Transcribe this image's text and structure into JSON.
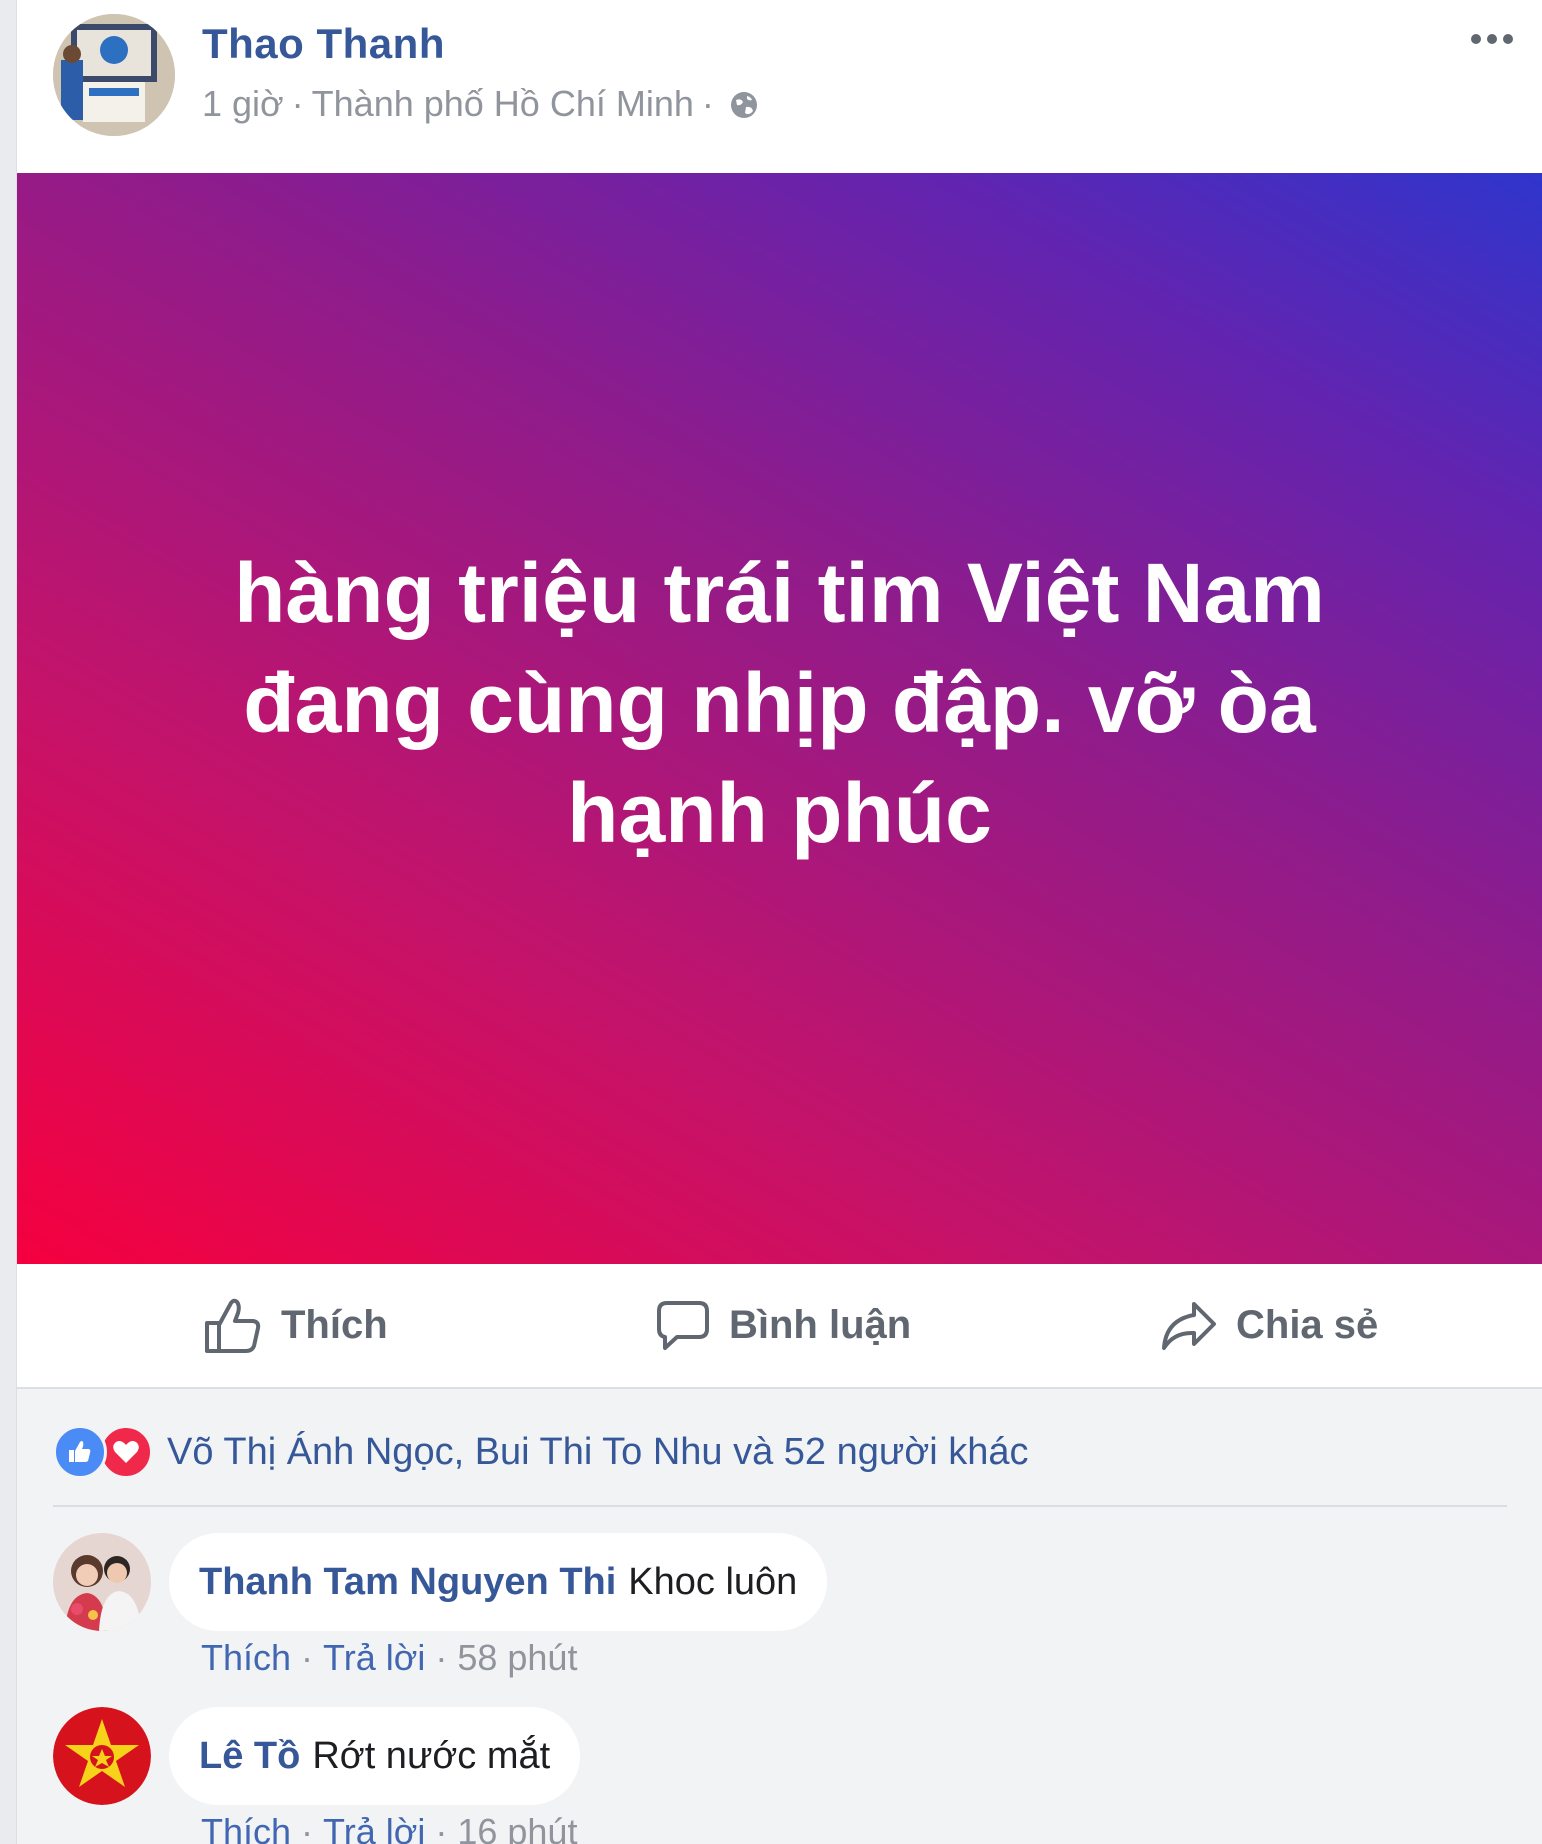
{
  "post": {
    "author": "Thao Thanh",
    "time": "1 giờ",
    "separator": "·",
    "location": "Thành phố Hồ Chí Minh",
    "privacy_icon": "globe-icon",
    "status_text": "hàng triệu trái tim Việt Nam đang cùng nhịp đập. vỡ òa hạnh phúc",
    "status_gradient": [
      "#f5003f",
      "#c4136a",
      "#8e1c8c",
      "#6224b0",
      "#2f35cc"
    ]
  },
  "actions": {
    "like": "Thích",
    "comment": "Bình luận",
    "share": "Chia sẻ"
  },
  "reactions": {
    "icons": [
      "like-icon",
      "love-icon"
    ],
    "text": "Võ Thị Ánh Ngọc, Bui Thi To Nhu và 52 người khác"
  },
  "comments": [
    {
      "author": "Thanh Tam Nguyen Thi",
      "text": "Khoc luôn",
      "like": "Thích",
      "reply": "Trả lời",
      "time": "58 phút"
    },
    {
      "author": "Lê Tồ",
      "text": "Rớt nước mắt",
      "like": "Thích",
      "reply": "Trả lời",
      "time": "16 phút"
    }
  ],
  "colors": {
    "link": "#365899",
    "meta": "#90949c",
    "action": "#606770",
    "comments_bg": "#f2f3f5"
  }
}
